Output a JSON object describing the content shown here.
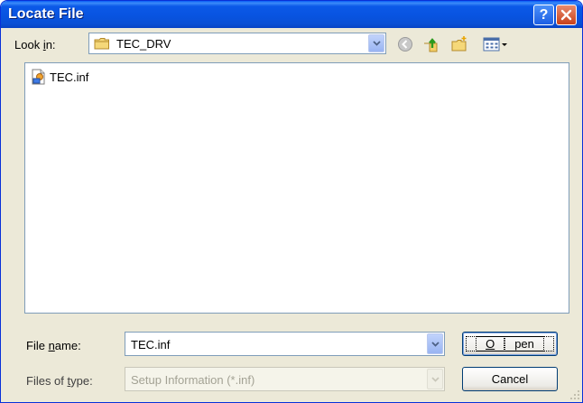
{
  "window": {
    "title": "Locate File"
  },
  "look_in": {
    "label_pre": "Look ",
    "label_key": "i",
    "label_post": "n:",
    "value": "TEC_DRV"
  },
  "toolbar": {
    "back": "back-icon",
    "up": "up-folder-icon",
    "new_folder": "new-folder-icon",
    "views": "views-menu-icon"
  },
  "files": [
    {
      "name": "TEC.inf",
      "icon": "setup-information-file-icon"
    }
  ],
  "file_name": {
    "label_pre": "File ",
    "label_key": "n",
    "label_post": "ame:",
    "value": "TEC.inf"
  },
  "file_type": {
    "label_pre": "Files of ",
    "label_key": "t",
    "label_post": "ype:",
    "value": "Setup Information (*.inf)"
  },
  "buttons": {
    "open_key": "O",
    "open_rest": "pen",
    "cancel": "Cancel"
  },
  "colors": {
    "titlebar": "#0853df",
    "dialog_bg": "#ece9d8",
    "close": "#c8421c"
  }
}
